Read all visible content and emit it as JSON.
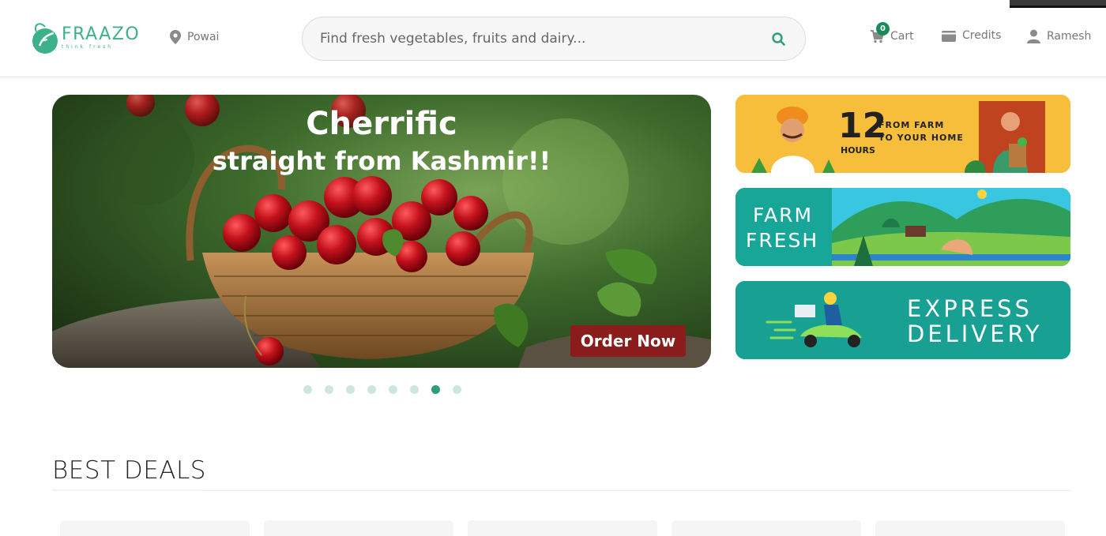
{
  "header": {
    "logo": {
      "name": "FRAAZO",
      "tagline": "think fresh"
    },
    "location": "Powai",
    "search": {
      "placeholder": "Find fresh vegetables, fruits and dairy..."
    },
    "cart": {
      "label": "Cart",
      "count": "0"
    },
    "credits": {
      "label": "Credits"
    },
    "user": {
      "label": "Ramesh"
    }
  },
  "hero": {
    "title": "Cherrific",
    "subtitle": "straight from Kashmir!!",
    "cta": "Order Now",
    "slides_total": 8,
    "active_slide": 7
  },
  "side_banners": {
    "b1": {
      "number": "12",
      "unit": "HOURS",
      "line1": "FROM FARM",
      "line2": "TO YOUR HOME"
    },
    "b2": {
      "line1": "FARM",
      "line2": "FRESH"
    },
    "b3": {
      "line1": "EXPRESS",
      "line2": "DELIVERY"
    }
  },
  "sections": {
    "best_deals": "BEST DEALS"
  },
  "colors": {
    "brand": "#3cb28a",
    "accent_dark": "#1b8a5a",
    "cta": "#8b1c1c",
    "banner_yellow": "#f6be3a",
    "banner_teal": "#17a697"
  }
}
